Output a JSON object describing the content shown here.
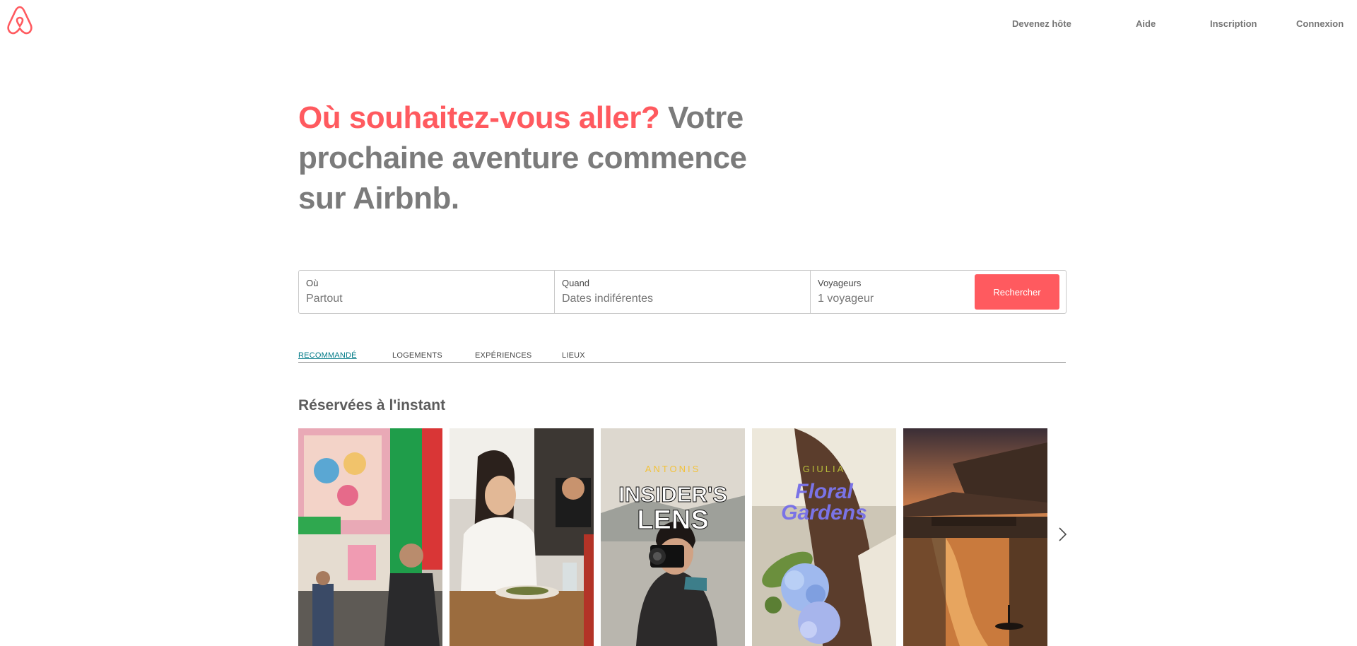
{
  "brand": {
    "name": "Airbnb",
    "color": "#ff5a5f"
  },
  "nav": {
    "host": "Devenez hôte",
    "help": "Aide",
    "signup": "Inscription",
    "login": "Connexion"
  },
  "hero": {
    "accent": "Où souhaitez-vous aller?",
    "rest": "Votre prochaine aventure commence sur Airbnb."
  },
  "search": {
    "where_label": "Où",
    "where_value": "Partout",
    "when_label": "Quand",
    "when_value": "Dates indiférentes",
    "guests_label": "Voyageurs",
    "guests_value": "1 voyageur",
    "button": "Rechercher"
  },
  "tabs": [
    {
      "label": "Recommandé",
      "active": true
    },
    {
      "label": "Logements",
      "active": false
    },
    {
      "label": "Expériences",
      "active": false
    },
    {
      "label": "Lieux",
      "active": false
    }
  ],
  "section": {
    "title": "Réservées à l'instant"
  },
  "cards": [
    {
      "image": "tokyo-street-photo"
    },
    {
      "image": "woman-eating-photo"
    },
    {
      "image": "photographer-photo",
      "host": "ANTONIS",
      "title_line1": "INSIDER'S",
      "title_line2": "LENS"
    },
    {
      "image": "hydrangea-photo",
      "host": "GIULIA",
      "title_line1": "Floral",
      "title_line2": "Gardens"
    },
    {
      "image": "florence-sunset-photo"
    }
  ],
  "icons": {
    "logo": "airbnb-logo-icon",
    "next": "chevron-right-icon"
  },
  "colors": {
    "accent": "#ff5a5f",
    "active_tab": "#007a87",
    "text_gray": "#7b7b7b"
  }
}
